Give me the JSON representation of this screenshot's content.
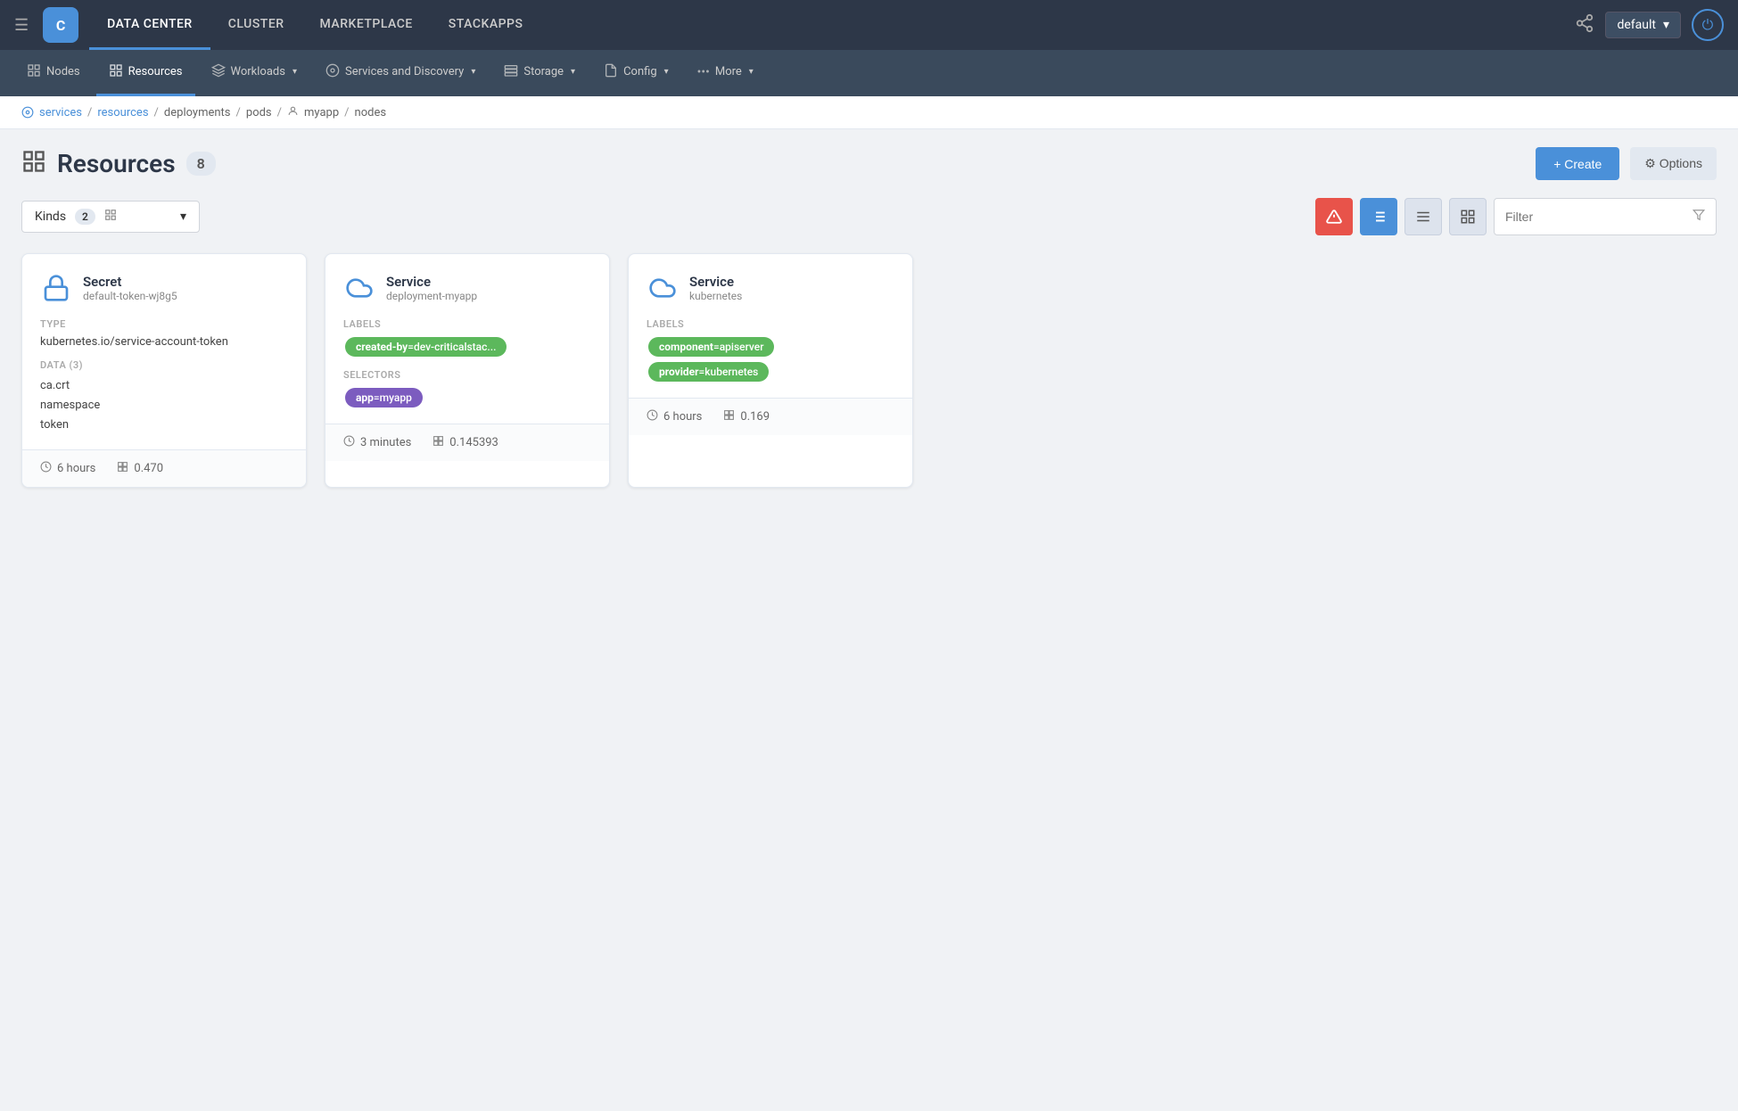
{
  "topNav": {
    "logo": "C",
    "items": [
      {
        "id": "datacenter",
        "label": "DATA CENTER",
        "active": true
      },
      {
        "id": "cluster",
        "label": "CLUSTER",
        "active": false
      },
      {
        "id": "marketplace",
        "label": "MARKETPLACE",
        "active": false
      },
      {
        "id": "stackapps",
        "label": "STACKAPPS",
        "active": false
      }
    ],
    "env": "default",
    "hamburger_label": "☰",
    "git_icon": "⑂",
    "power_icon": "⏻"
  },
  "secondNav": {
    "items": [
      {
        "id": "nodes",
        "label": "Nodes",
        "icon": "⬡",
        "active": false,
        "hasDropdown": false
      },
      {
        "id": "resources",
        "label": "Resources",
        "icon": "⊞",
        "active": true,
        "hasDropdown": false
      },
      {
        "id": "workloads",
        "label": "Workloads",
        "icon": "↓",
        "active": false,
        "hasDropdown": true
      },
      {
        "id": "services",
        "label": "Services and Discovery",
        "icon": "◉",
        "active": false,
        "hasDropdown": true
      },
      {
        "id": "storage",
        "label": "Storage",
        "icon": "⊟",
        "active": false,
        "hasDropdown": true
      },
      {
        "id": "config",
        "label": "Config",
        "icon": "📋",
        "active": false,
        "hasDropdown": true
      },
      {
        "id": "more",
        "label": "More",
        "icon": "•••",
        "active": false,
        "hasDropdown": true
      }
    ]
  },
  "breadcrumb": {
    "items": [
      {
        "label": "services",
        "link": true
      },
      {
        "label": "resources",
        "link": true
      },
      {
        "label": "deployments",
        "link": false
      },
      {
        "label": "pods",
        "link": false
      },
      {
        "label": "myapp",
        "link": false,
        "hasIcon": true
      },
      {
        "label": "nodes",
        "link": false
      }
    ]
  },
  "pageHeader": {
    "icon": "⊞",
    "title": "Resources",
    "count": "8",
    "createLabel": "+ Create",
    "optionsLabel": "⚙ Options"
  },
  "toolbar": {
    "kinds": {
      "label": "Kinds",
      "count": "2",
      "icon": "⊞"
    },
    "filterPlaceholder": "Filter",
    "warningBtn": "⚠",
    "sortBtn": "↕",
    "listBtn": "☰",
    "groupBtn": "⊞"
  },
  "cards": [
    {
      "kind": "Secret",
      "name": "default-token-wj8g5",
      "iconType": "lock",
      "sections": [
        {
          "label": "TYPE",
          "type": "text",
          "value": "kubernetes.io/service-account-token"
        },
        {
          "label": "DATA (3)",
          "type": "list",
          "items": [
            "ca.crt",
            "namespace",
            "token"
          ]
        }
      ],
      "footer": {
        "time": "6 hours",
        "value": "0.470"
      }
    },
    {
      "kind": "Service",
      "name": "deployment-myapp",
      "iconType": "cloud",
      "sections": [
        {
          "label": "LABELS",
          "type": "tags",
          "tags": [
            {
              "key": "created-by",
              "value": "dev-criticalstac...",
              "color": "green"
            }
          ]
        },
        {
          "label": "SELECTORS",
          "type": "tags",
          "tags": [
            {
              "key": "app",
              "value": "myapp",
              "color": "purple"
            }
          ]
        }
      ],
      "footer": {
        "time": "3 minutes",
        "value": "0.145393"
      }
    },
    {
      "kind": "Service",
      "name": "kubernetes",
      "iconType": "cloud",
      "sections": [
        {
          "label": "LABELS",
          "type": "tags",
          "tags": [
            {
              "key": "component",
              "value": "apiserver",
              "color": "green"
            },
            {
              "key": "provider",
              "value": "kubernetes",
              "color": "green"
            }
          ]
        }
      ],
      "footer": {
        "time": "6 hours",
        "value": "0.169"
      }
    }
  ]
}
